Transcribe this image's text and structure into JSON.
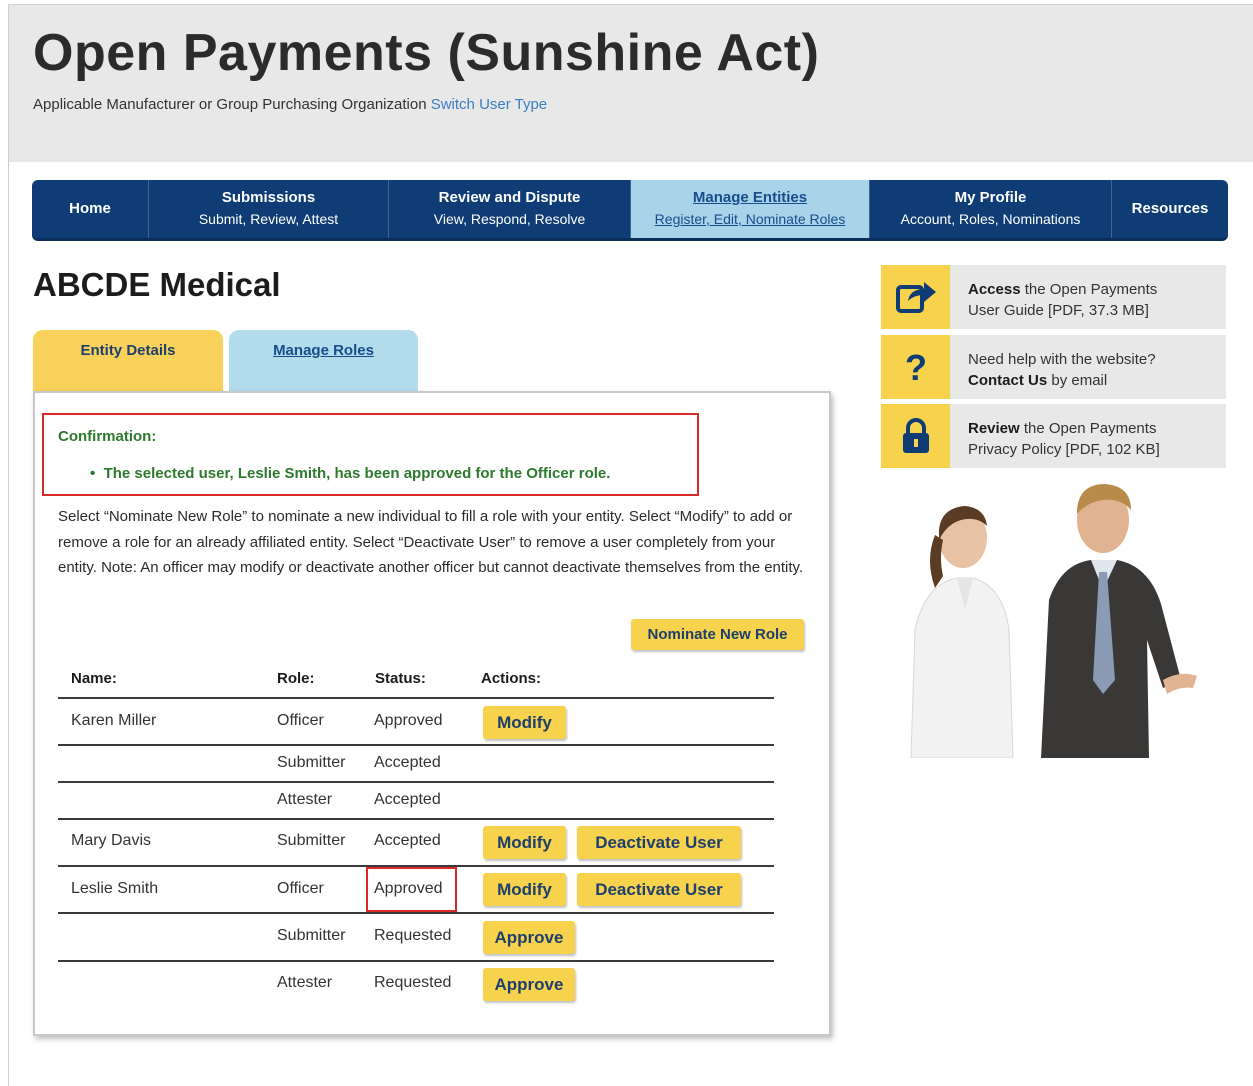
{
  "header": {
    "title": "Open Payments (Sunshine Act)",
    "subtitle": "Applicable Manufacturer or Group Purchasing Organization",
    "switch_link": "Switch User Type"
  },
  "nav": [
    {
      "title": "Home",
      "sub": ""
    },
    {
      "title": "Submissions",
      "sub": "Submit, Review, Attest"
    },
    {
      "title": "Review and Dispute",
      "sub": "View, Respond, Resolve"
    },
    {
      "title": "Manage Entities",
      "sub": "Register, Edit, Nominate Roles",
      "active": true
    },
    {
      "title": "My Profile",
      "sub": "Account, Roles, Nominations"
    },
    {
      "title": "Resources",
      "sub": ""
    }
  ],
  "entity_name": "ABCDE Medical",
  "tabs": {
    "entity_details": "Entity Details",
    "manage_roles": "Manage Roles"
  },
  "confirmation": {
    "title": "Confirmation:",
    "message": "The selected user, Leslie Smith, has been approved for the Officer role."
  },
  "instructions": "Select “Nominate New Role” to nominate a new individual to fill a role with your entity. Select “Modify” to add or remove a role for an already affiliated entity. Select “Deactivate User” to remove a user completely from your entity. Note: An officer may modify or deactivate another officer but cannot deactivate themselves from the entity.",
  "nominate_button": "Nominate New Role",
  "table": {
    "headers": {
      "name": "Name:",
      "role": "Role:",
      "status": "Status:",
      "actions": "Actions:"
    },
    "rows": [
      {
        "name": "Karen Miller",
        "role": "Officer",
        "status": "Approved",
        "actions": [
          "Modify"
        ]
      },
      {
        "name": "",
        "role": "Submitter",
        "status": "Accepted",
        "actions": []
      },
      {
        "name": "",
        "role": "Attester",
        "status": "Accepted",
        "actions": []
      },
      {
        "name": "Mary Davis",
        "role": "Submitter",
        "status": "Accepted",
        "actions": [
          "Modify",
          "Deactivate User"
        ]
      },
      {
        "name": "Leslie Smith",
        "role": "Officer",
        "status": "Approved",
        "actions": [
          "Modify",
          "Deactivate User"
        ]
      },
      {
        "name": "",
        "role": "Submitter",
        "status": "Requested",
        "actions": [
          "Approve"
        ]
      },
      {
        "name": "",
        "role": "Attester",
        "status": "Requested",
        "actions": [
          "Approve"
        ]
      }
    ]
  },
  "sidebar": [
    {
      "icon": "share-icon",
      "bold": "Access",
      "text": " the Open Payments",
      "line2": "User Guide [PDF, 37.3 MB]"
    },
    {
      "icon": "question-icon",
      "bold": "",
      "text": "Need help with the website?",
      "line2_bold": "Contact Us",
      "line2": " by email"
    },
    {
      "icon": "lock-icon",
      "bold": "Review",
      "text": " the Open Payments",
      "line2": "Privacy Policy [PDF, 102 KB]"
    }
  ],
  "colors": {
    "nav_bg": "#0f3c74",
    "nav_active": "#a9d3e8",
    "button_yellow": "#f7d34d",
    "confirm_green": "#2d7a2d",
    "highlight_red": "#d9292b"
  }
}
